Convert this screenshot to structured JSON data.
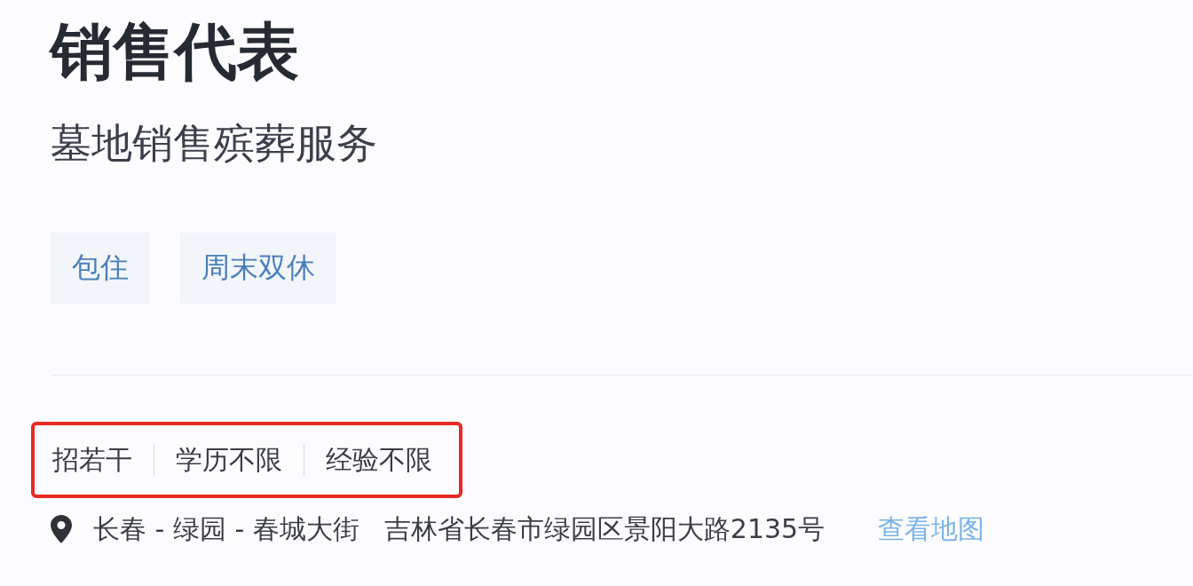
{
  "job": {
    "title": "销售代表",
    "subtitle": "墓地销售殡葬服务"
  },
  "tags": [
    "包住",
    "周末双休"
  ],
  "requirements": {
    "highlighted": true,
    "items": [
      "招若干",
      "学历不限",
      "经验不限"
    ]
  },
  "location": {
    "area": "长春 - 绿园 - 春城大街",
    "address": "吉林省长春市绿园区景阳大路2135号",
    "map_link": "查看地图"
  }
}
